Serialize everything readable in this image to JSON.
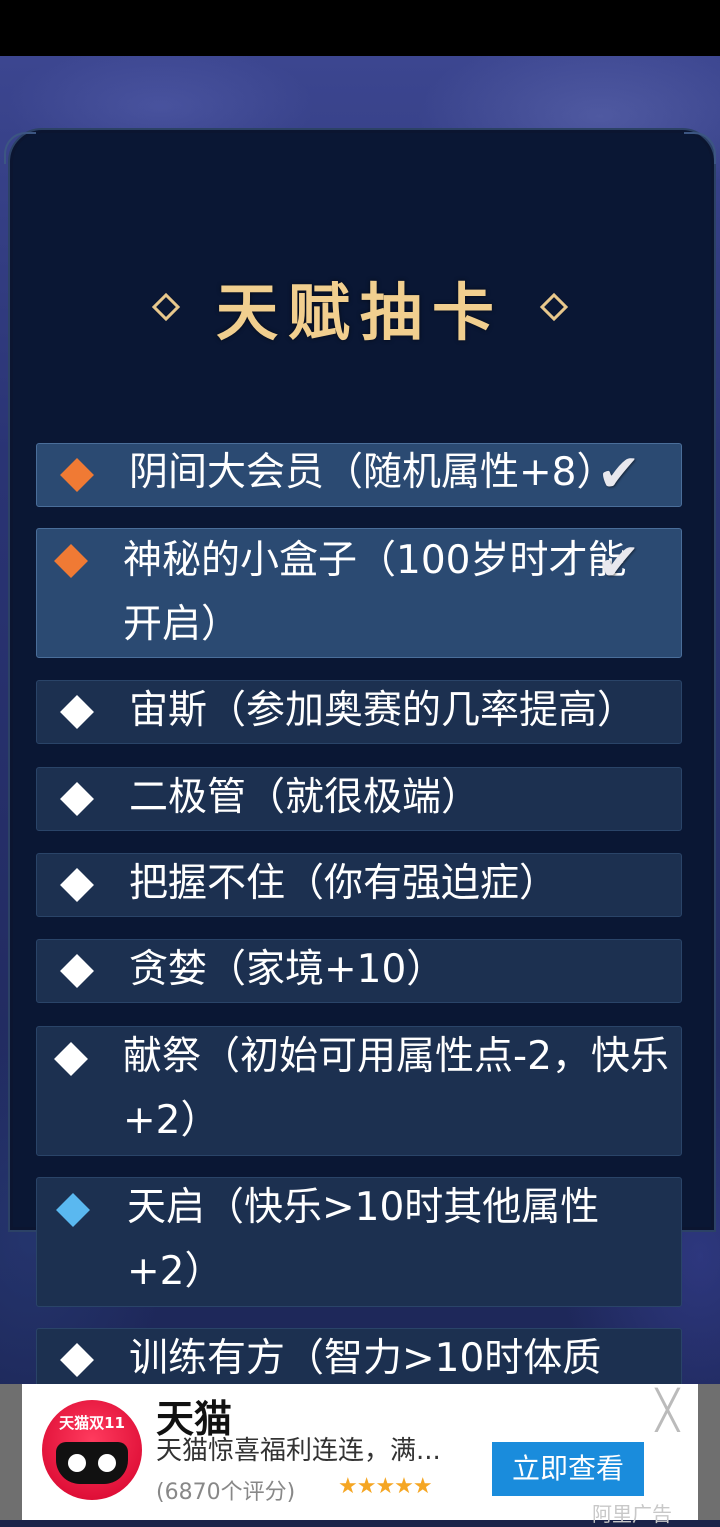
{
  "title": "天赋抽卡",
  "talents": [
    {
      "text": "阴间大会员（随机属性+8）",
      "gem_color": "#f07a34",
      "selected": true
    },
    {
      "text": "神秘的小盒子（100岁时才能开启）",
      "gem_color": "#f07a34",
      "selected": true
    },
    {
      "text": "宙斯（参加奥赛的几率提高）",
      "gem_color": "#ffffff",
      "selected": false
    },
    {
      "text": "二极管（就很极端）",
      "gem_color": "#ffffff",
      "selected": false
    },
    {
      "text": "把握不住（你有强迫症）",
      "gem_color": "#ffffff",
      "selected": false
    },
    {
      "text": "贪婪（家境+10）",
      "gem_color": "#ffffff",
      "selected": false
    },
    {
      "text": "献祭（初始可用属性点-2，快乐+2）",
      "gem_color": "#ffffff",
      "selected": false
    },
    {
      "text": "天启（快乐>10时其他属性+2）",
      "gem_color": "#5ab8f0",
      "selected": false
    },
    {
      "text": "训练有方（智力>10时体质",
      "gem_color": "#ffffff",
      "selected": false
    }
  ],
  "ad": {
    "logo_text": "天猫双11",
    "title": "天猫",
    "description": "天猫惊喜福利连连，满...",
    "rating": "(6870个评分)",
    "stars": "★★★★★",
    "cta": "立即查看",
    "close": "╳",
    "tag": "阿里广告"
  }
}
